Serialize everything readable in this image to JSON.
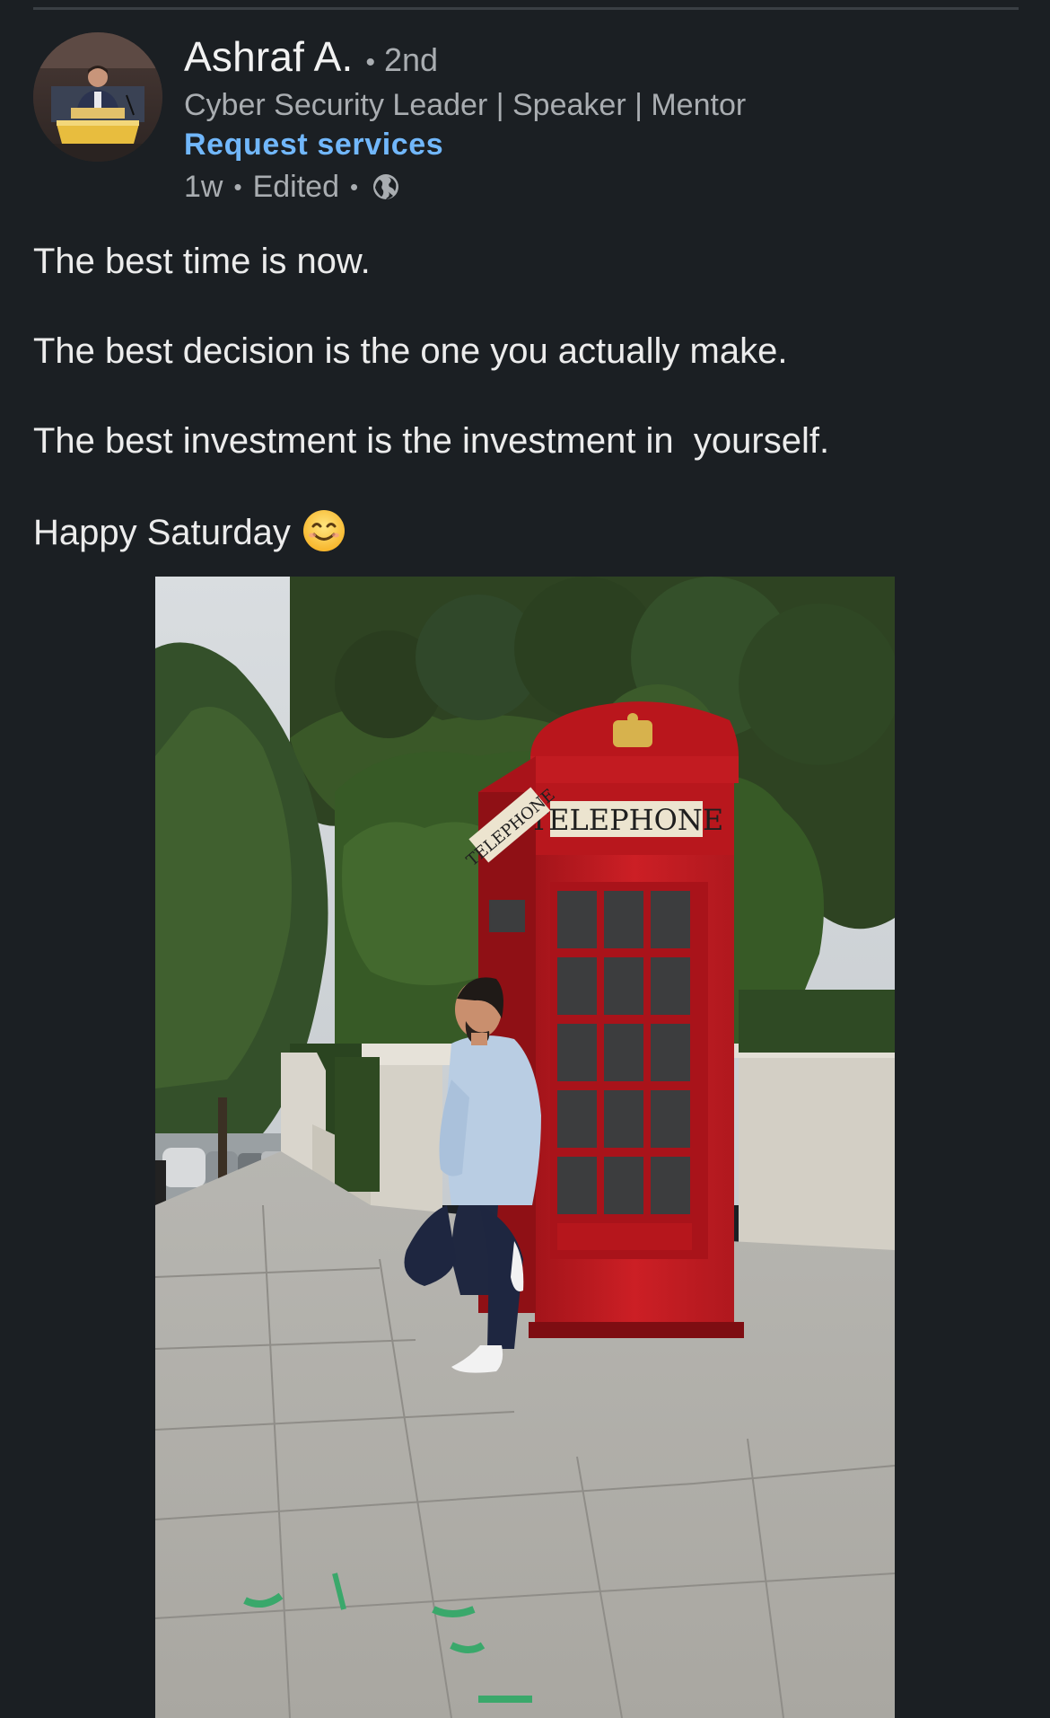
{
  "colors": {
    "background": "#1b1f23",
    "text_primary": "#f2f2f2",
    "text_secondary": "#a9adb1",
    "link": "#71b7fb"
  },
  "post": {
    "author": {
      "name": "Ashraf A.",
      "separator": "•",
      "degree": "2nd",
      "headline": "Cyber Security Leader | Speaker | Mentor",
      "request_services_label": "Request services",
      "avatar_icon": "profile-photo"
    },
    "meta": {
      "time": "1w",
      "separator": "•",
      "edited": "Edited",
      "visibility_icon": "globe-icon"
    },
    "body": {
      "lines": [
        "The best time is now.",
        "The best decision is the one you actually make.",
        "The best investment is the investment in  yourself.",
        "Happy Saturday"
      ],
      "emoji": "smiling-face-icon"
    },
    "image": {
      "booth_sign_front": "TELEPHONE",
      "booth_sign_side": "TELEPHONE"
    }
  }
}
